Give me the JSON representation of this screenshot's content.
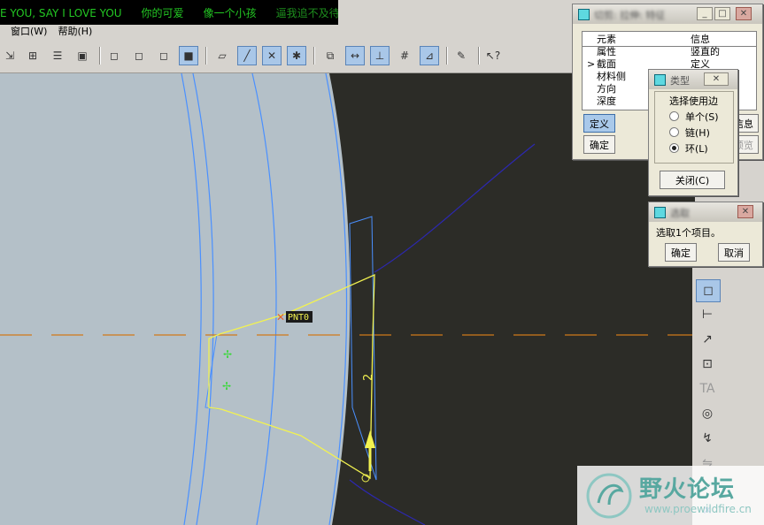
{
  "lyrics": [
    "E YOU, SAY I LOVE YOU",
    "你的可爱",
    "像一个小孩",
    "逼我追不及待"
  ],
  "menu": [
    {
      "label": "窗口(W)"
    },
    {
      "label": "帮助(H)"
    }
  ],
  "colors": {
    "viewport": "#2c2c27",
    "part": "#b4c0c8",
    "edge": "#4a90ff",
    "sketch": "#f2f250",
    "centerline": "#d07818",
    "curve": "#2c28b0",
    "accent": "#a9c9ea"
  },
  "viewport": {
    "datum_label": "PNT0",
    "dimension_label": "2"
  },
  "feature_dialog": {
    "title": "切剪: 拉伸: 特征",
    "header": {
      "col1": "元素",
      "col2": "信息"
    },
    "rows": [
      {
        "marker": "",
        "name": "属性",
        "info": "竖直的"
      },
      {
        "marker": ">",
        "name": "截面",
        "info": "定义"
      },
      {
        "marker": "",
        "name": "材料侧",
        "info": ""
      },
      {
        "marker": "",
        "name": "方向",
        "info": ""
      },
      {
        "marker": "",
        "name": "深度",
        "info": ""
      }
    ],
    "define_btn": "定义",
    "ok_btn": "确定",
    "info_btn": "信息",
    "preview_btn": "预览"
  },
  "type_dialog": {
    "title": "类型",
    "group_label": "选择使用边",
    "options": [
      {
        "label": "单个(S)",
        "selected": false
      },
      {
        "label": "链(H)",
        "selected": false
      },
      {
        "label": "环(L)",
        "selected": true
      }
    ],
    "close_btn": "关闭(C)"
  },
  "select_dialog": {
    "title": "选取",
    "message": "选取1个项目。",
    "ok_btn": "确定",
    "cancel_btn": "取消"
  },
  "watermark": {
    "name": "野火论坛",
    "url": "www.proewildfire.cn"
  }
}
